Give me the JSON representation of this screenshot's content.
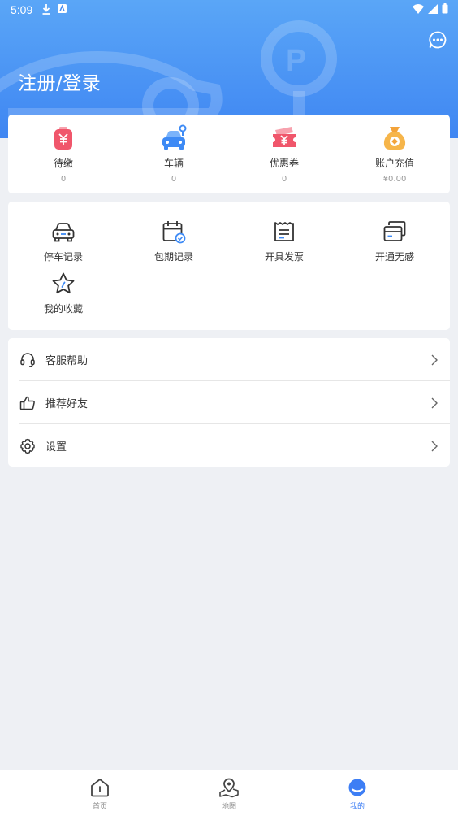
{
  "status_bar": {
    "time": "5:09"
  },
  "header": {
    "login_label": "注册/登录"
  },
  "stats": [
    {
      "label": "待缴",
      "value": "0",
      "icon": "unpaid-bill-icon"
    },
    {
      "label": "车辆",
      "value": "0",
      "icon": "vehicle-icon"
    },
    {
      "label": "优惠券",
      "value": "0",
      "icon": "coupon-icon"
    },
    {
      "label": "账户充值",
      "value": "¥0.00",
      "icon": "money-bag-icon"
    }
  ],
  "services": [
    {
      "label": "停车记录",
      "icon": "car-icon"
    },
    {
      "label": "包期记录",
      "icon": "calendar-check-icon"
    },
    {
      "label": "开具发票",
      "icon": "invoice-icon"
    },
    {
      "label": "开通无感",
      "icon": "card-icon"
    },
    {
      "label": "我的收藏",
      "icon": "star-icon"
    }
  ],
  "menu": [
    {
      "label": "客服帮助",
      "icon": "headset-icon"
    },
    {
      "label": "推荐好友",
      "icon": "thumbs-up-icon"
    },
    {
      "label": "设置",
      "icon": "gear-icon"
    }
  ],
  "tabbar": [
    {
      "label": "首页",
      "icon": "home-icon"
    },
    {
      "label": "地图",
      "icon": "map-pin-icon"
    },
    {
      "label": "我的",
      "icon": "profile-icon",
      "active": true
    }
  ],
  "colors": {
    "primary": "#3f86f2",
    "accent_red": "#f0566b",
    "accent_orange": "#f3a33a"
  }
}
